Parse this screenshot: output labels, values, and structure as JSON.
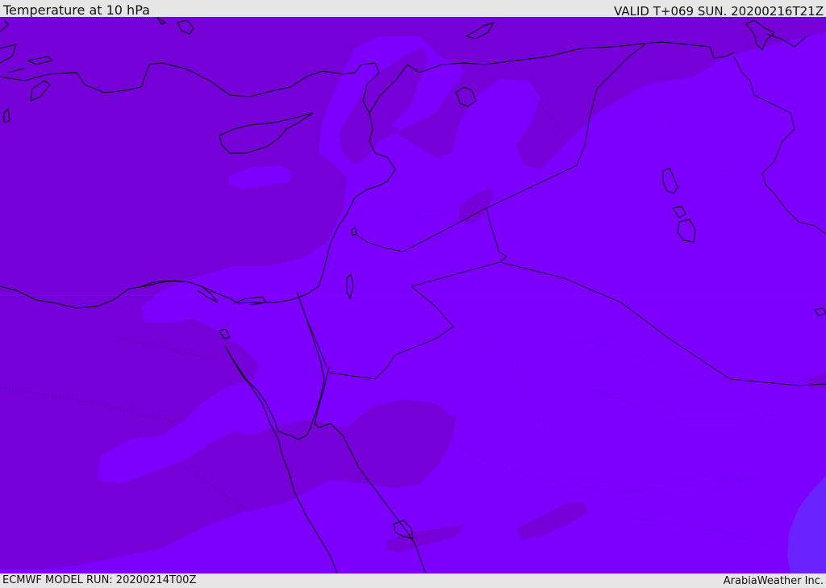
{
  "header": {
    "title": "Temperature at 10 hPa",
    "valid": "VALID T+069 SUN. 20200216T21Z"
  },
  "footer": {
    "model_run": "ECMWF MODEL RUN: 20200214T00Z",
    "credit": "ArabiaWeather Inc."
  },
  "map": {
    "field": "temperature",
    "level": "10 hPa",
    "colors": {
      "cold_band": "#7600d8",
      "main_field": "#7d00ff",
      "warm_corner": "#6a22ff",
      "coastline": "#000000"
    }
  }
}
